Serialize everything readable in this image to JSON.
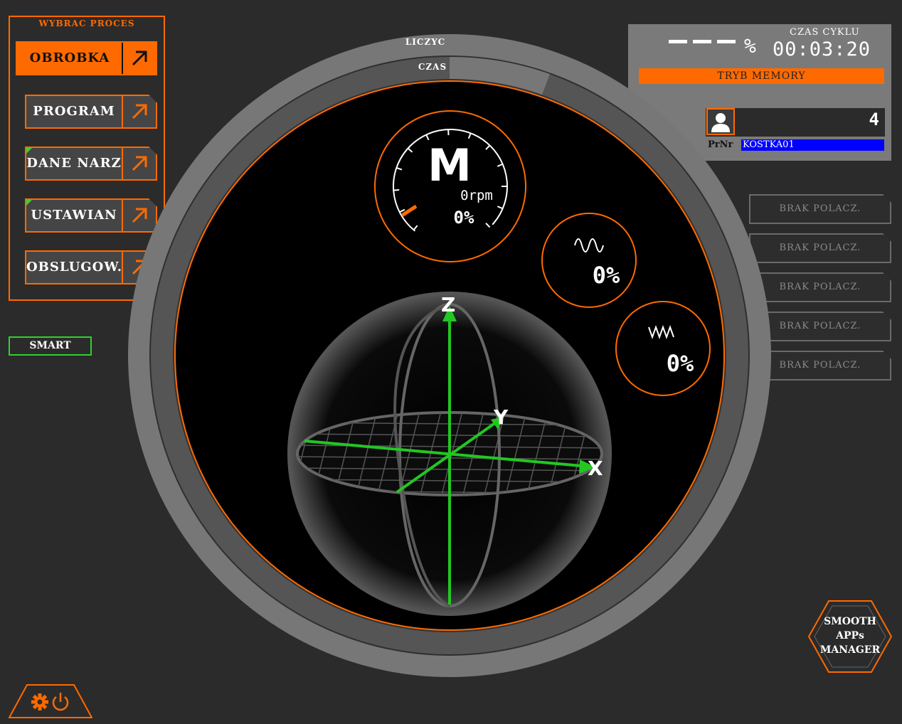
{
  "process_panel": {
    "title": "WYBRAC PROCES",
    "buttons": [
      {
        "label": "OBROBKA",
        "active": true
      },
      {
        "label": "PROGRAM",
        "active": false
      },
      {
        "label": "DANE NARZ",
        "active": false
      },
      {
        "label": "USTAWIAN",
        "active": false
      },
      {
        "label": "OBSLUGOW.",
        "active": false
      }
    ]
  },
  "smart_button": "SMART",
  "status": {
    "percent_symbol": "%",
    "cycle_label": "CZAS CYKLU",
    "cycle_time": "00:03:20",
    "mode": "TRYB MEMORY",
    "user_count": "4",
    "prnr_label": "PrNr",
    "prnr_value": "KOSTKA01"
  },
  "connections": [
    "BRAK POLACZ.",
    "BRAK POLACZ.",
    "BRAK POLACZ.",
    "BRAK POLACZ.",
    "BRAK POLACZ."
  ],
  "dial": {
    "outer_label": "LICZYC",
    "inner_label": "CZAS",
    "spindle_letter": "M",
    "spindle_rpm": "0rpm",
    "spindle_override": "0%",
    "feed_override": "0%",
    "rapid_override": "0%",
    "axes": {
      "z": "Z",
      "y": "Y",
      "x": "X"
    }
  },
  "smooth_apps": {
    "line1": "SMOOTH",
    "line2": "APPs",
    "line3": "MANAGER"
  },
  "colors": {
    "accent": "#ff6a00",
    "axis": "#22c722",
    "prnr_bg": "#0000ff",
    "smart_border": "#2fd12f"
  },
  "icons": [
    "arrow-up-right-icon",
    "user-icon",
    "sine-wave-icon",
    "zigzag-wave-icon",
    "gear-icon",
    "power-icon"
  ]
}
